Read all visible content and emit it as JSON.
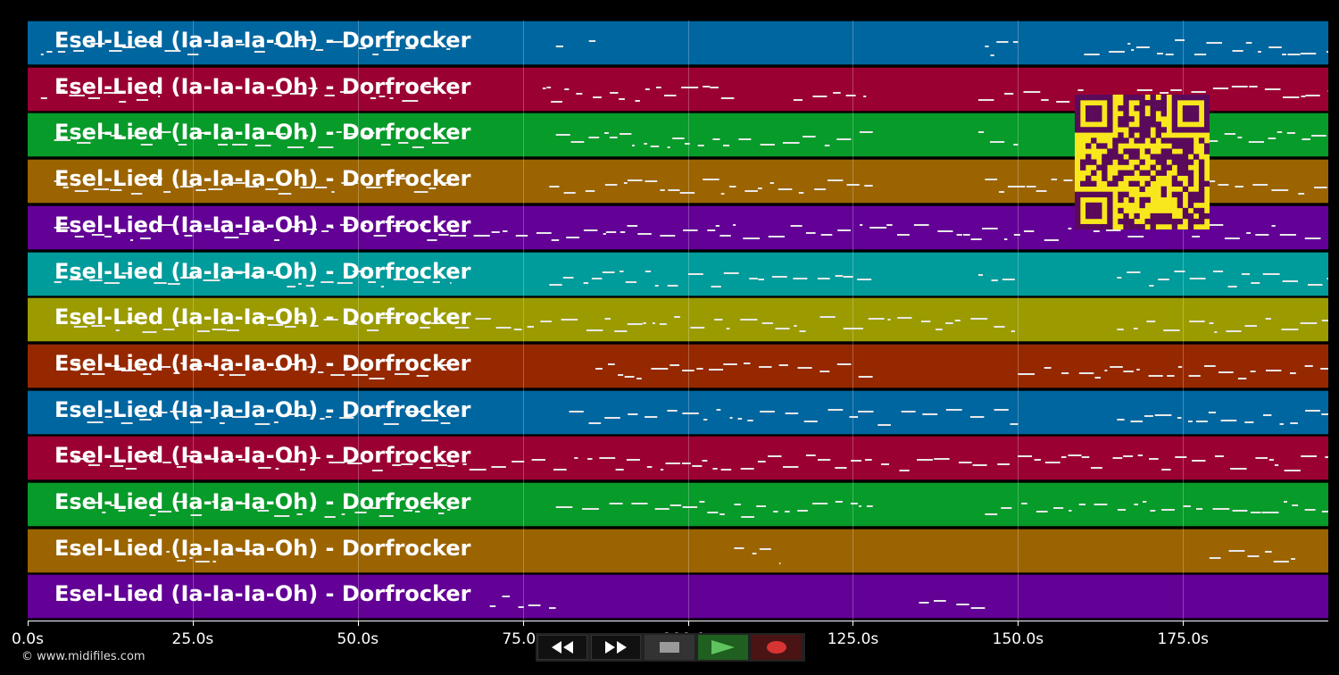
{
  "tracks": [
    {
      "title": "Esel-Lied (Ia-Ia-Ia-Oh) - Dorfrocker",
      "color": "#0066a0"
    },
    {
      "title": "Esel-Lied (Ia-Ia-Ia-Oh) - Dorfrocker",
      "color": "#9b0033"
    },
    {
      "title": "Esel-Lied (Ia-Ia-Ia-Oh) - Dorfrocker",
      "color": "#079b2a"
    },
    {
      "title": "Esel-Lied (Ia-Ia-Ia-Oh) - Dorfrocker",
      "color": "#9b6400"
    },
    {
      "title": "Esel-Lied (Ia-Ia-Ia-Oh) - Dorfrocker",
      "color": "#630096"
    },
    {
      "title": "Esel-Lied (Ia-Ia-Ia-Oh) - Dorfrocker",
      "color": "#009b9b"
    },
    {
      "title": "Esel-Lied (Ia-Ia-Ia-Oh) - Dorfrocker",
      "color": "#9b9b00"
    },
    {
      "title": "Esel-Lied (Ia-Ia-Ia-Oh) - Dorfrocker",
      "color": "#962800"
    },
    {
      "title": "Esel-Lied (Ia-Ia-Ia-Oh) - Dorfrocker",
      "color": "#0066a0"
    },
    {
      "title": "Esel-Lied (Ia-Ia-Ia-Oh) - Dorfrocker",
      "color": "#9b0033"
    },
    {
      "title": "Esel-Lied (Ia-Ia-Ia-Oh) - Dorfrocker",
      "color": "#079b2a"
    },
    {
      "title": "Esel-Lied (Ia-Ia-Ia-Oh) - Dorfrocker",
      "color": "#9b6400"
    },
    {
      "title": "Esel-Lied (Ia-Ia-Ia-Oh) - Dorfrocker",
      "color": "#630096"
    }
  ],
  "xaxis": {
    "max": 197,
    "ticks": [
      {
        "value": 0,
        "label": "0.0s"
      },
      {
        "value": 25,
        "label": "25.0s"
      },
      {
        "value": 50,
        "label": "50.0s"
      },
      {
        "value": 75,
        "label": "75.0s"
      },
      {
        "value": 100,
        "label": "100.0s"
      },
      {
        "value": 125,
        "label": "125.0s"
      },
      {
        "value": 150,
        "label": "150.0s"
      },
      {
        "value": 175,
        "label": "175.0s"
      }
    ]
  },
  "copyright": "© www.midifiles.com",
  "controls": [
    {
      "name": "rewind-button",
      "icon": "rewind-icon"
    },
    {
      "name": "fast-forward-button",
      "icon": "fast-forward-icon"
    },
    {
      "name": "stop-button",
      "icon": "stop-icon"
    },
    {
      "name": "play-button",
      "icon": "play-icon"
    },
    {
      "name": "record-button",
      "icon": "record-icon"
    }
  ],
  "qr": {
    "fg": "#5a0a5a",
    "bg": "#f8e71c",
    "icon": "qr-code-icon"
  }
}
